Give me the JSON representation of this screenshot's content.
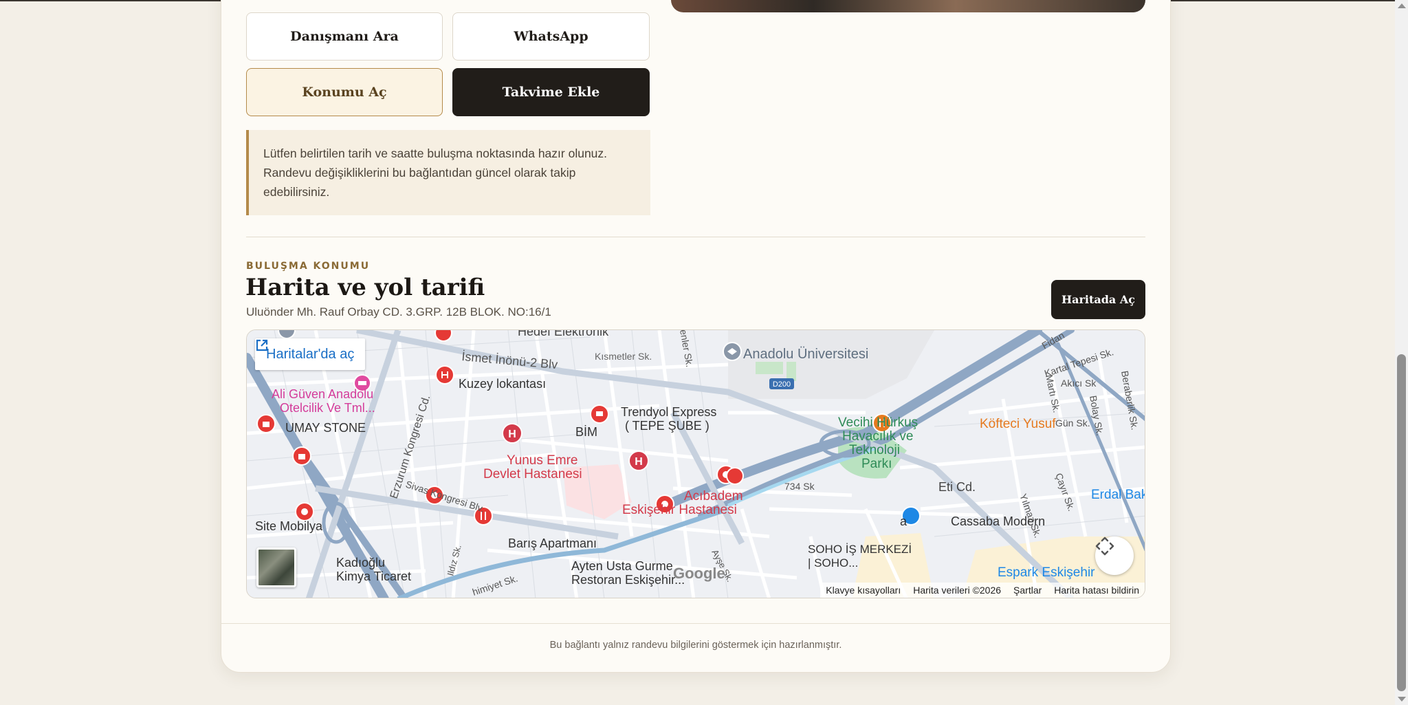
{
  "buttons": {
    "call_advisor": "Danışmanı Ara",
    "whatsapp": "WhatsApp",
    "open_location": "Konumu Aç",
    "add_calendar": "Takvime Ekle"
  },
  "note": {
    "line1": "Lütfen belirtilen tarih ve saatte buluşma noktasında hazır olunuz.",
    "line2": "Randevu değişikliklerini bu bağlantıdan güncel olarak takip",
    "line3": "edebilirsiniz."
  },
  "location": {
    "eyebrow": "BULUŞMA KONUMU",
    "title": "Harita ve yol tarifi",
    "address": "Uluönder Mh. Rauf Orbay CD. 3.GRP. 12B BLOK. NO:16/1",
    "open_map_button": "Haritada Aç"
  },
  "map": {
    "open_in_maps": "Haritalar'da aç",
    "google": "Google",
    "attribution": {
      "shortcuts": "Klavye kısayolları",
      "data": "Harita verileri ©2026",
      "terms": "Şartlar",
      "report": "Harita hatası bildirin"
    },
    "labels": {
      "anadolu": "Anadolu Üniversitesi",
      "hedef": "Hedef Elektronik",
      "ismet": "İsmet İnönü-2 Blv",
      "kismetler": "Kısmetler Sk.",
      "kuzey": "Kuzey lokantası",
      "aliguven1": "Ali Güven Anadolu",
      "aliguven2": "Otelcilik Ve Tml...",
      "umay": "UMAY STONE",
      "erzurum": "Erzurum Kongresi Cd.",
      "yunus1": "Yunus Emre",
      "yunus2": "Devlet Hastanesi",
      "bim": "BİM",
      "trendyol1": "Trendyol Express",
      "trendyol2": "( TEPE ŞUBE )",
      "vecihi1": "Vecihi Hürkuş",
      "vecihi2": "Havacılık ve",
      "vecihi3": "Teknoloji",
      "vecihi4": "Parkı",
      "kofteci": "Köfteci Yusuf",
      "d200": "D200",
      "sivas": "Sivas Kongresi Blv.",
      "acibadem1": "Acıbadem",
      "acibadem2": "Eskişehir Hastanesi",
      "s734": "734 Sk",
      "eti": "Eti Cd.",
      "erdal": "Erdal Bakk",
      "site": "Site Mobilya",
      "baris": "Barış Apartmanı",
      "cassaba": "Cassaba Modern",
      "a": "a",
      "kadioglu1": "Kadıoğlu",
      "kadioglu2": "Kimya Ticaret",
      "ayten1": "Ayten Usta Gurme",
      "ayten2": "Restoran Eskişehir...",
      "soho1": "SOHO İŞ MERKEZİ",
      "soho2": "| SOHO...",
      "espark": "Espark Eskişehir",
      "fidan": "Fidan",
      "kartal": "Kartal Tepesi Sk.",
      "akici": "Akıcı Sk",
      "berberlik": "Beraberlik Sk.",
      "gun": "Gün Sk.",
      "bolay": "Bolay Sk.",
      "marti": "Martı Sk.",
      "cayir": "Çayır Sk.",
      "yilmaz": "Yılmaz Sk.",
      "ildiz": "Ildız Sk.",
      "himiyet": "himiyet Sk.",
      "ayse": "Ayşe Sk.",
      "enler": "enler Sk."
    }
  },
  "footer": "Bu bağlantı yalnız randevu bilgilerini göstermek için hazırlanmıştır.",
  "colors": {
    "dark": "#211d19",
    "accent": "#b48a4a",
    "map_link": "#1a6fc6",
    "poi_red": "#e53935",
    "hospital": "#d33a4a"
  }
}
